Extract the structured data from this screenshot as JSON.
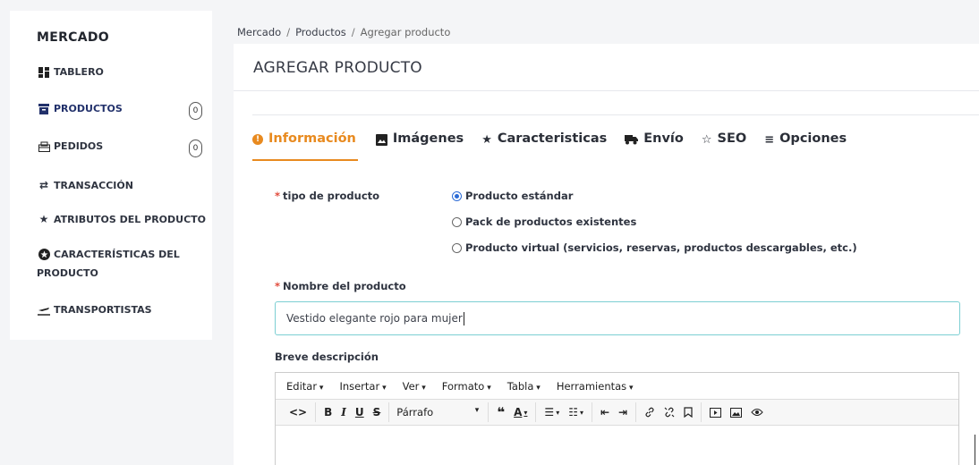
{
  "sidebar": {
    "title": "MERCADO",
    "items": [
      {
        "label": "TABLERO",
        "icon": "dashboard-icon"
      },
      {
        "label": "PRODUCTOS",
        "icon": "box-icon",
        "badge": "0",
        "active": true
      },
      {
        "label": "PEDIDOS",
        "icon": "orders-icon",
        "badge": "0"
      },
      {
        "label": "TRANSACCIÓN",
        "icon": "transfer-icon"
      },
      {
        "label": "ATRIBUTOS DEL PRODUCTO",
        "icon": "star-icon"
      },
      {
        "label_line1": "CARACTERÍSTICAS DEL",
        "label_line2": "PRODUCTO",
        "icon": "features-icon"
      },
      {
        "label": "TRANSPORTISTAS",
        "icon": "plane-icon"
      }
    ]
  },
  "breadcrumb": {
    "root": "Mercado",
    "section": "Productos",
    "current": "Agregar producto",
    "separator": "/"
  },
  "page": {
    "title": "AGREGAR PRODUCTO"
  },
  "tabs": [
    {
      "label": "Información",
      "icon": "info-icon",
      "active": true
    },
    {
      "label": "Imágenes",
      "icon": "image-icon"
    },
    {
      "label": "Caracteristicas",
      "icon": "star-icon"
    },
    {
      "label": "Envío",
      "icon": "truck-icon"
    },
    {
      "label": "SEO",
      "icon": "star-outline-icon"
    },
    {
      "label": "Opciones",
      "icon": "list-icon"
    }
  ],
  "form": {
    "product_type": {
      "required_mark": "*",
      "label": "tipo de producto",
      "options": [
        "Producto estándar",
        "Pack de productos existentes",
        "Producto virtual (servicios, reservas, productos descargables, etc.)"
      ],
      "selected": "Producto estándar"
    },
    "name": {
      "required_mark": "*",
      "label": "Nombre del producto",
      "value": "Vestido elegante rojo para mujer"
    },
    "short_description": {
      "label": "Breve descripción"
    }
  },
  "editor": {
    "menus": [
      "Editar",
      "Insertar",
      "Ver",
      "Formato",
      "Tabla",
      "Herramientas"
    ],
    "block_format": "Párrafo"
  },
  "colors": {
    "accent": "#e88a1f",
    "input_focus": "#7ccfd3",
    "required": "#e1493a",
    "radio": "#2b6bd6"
  }
}
